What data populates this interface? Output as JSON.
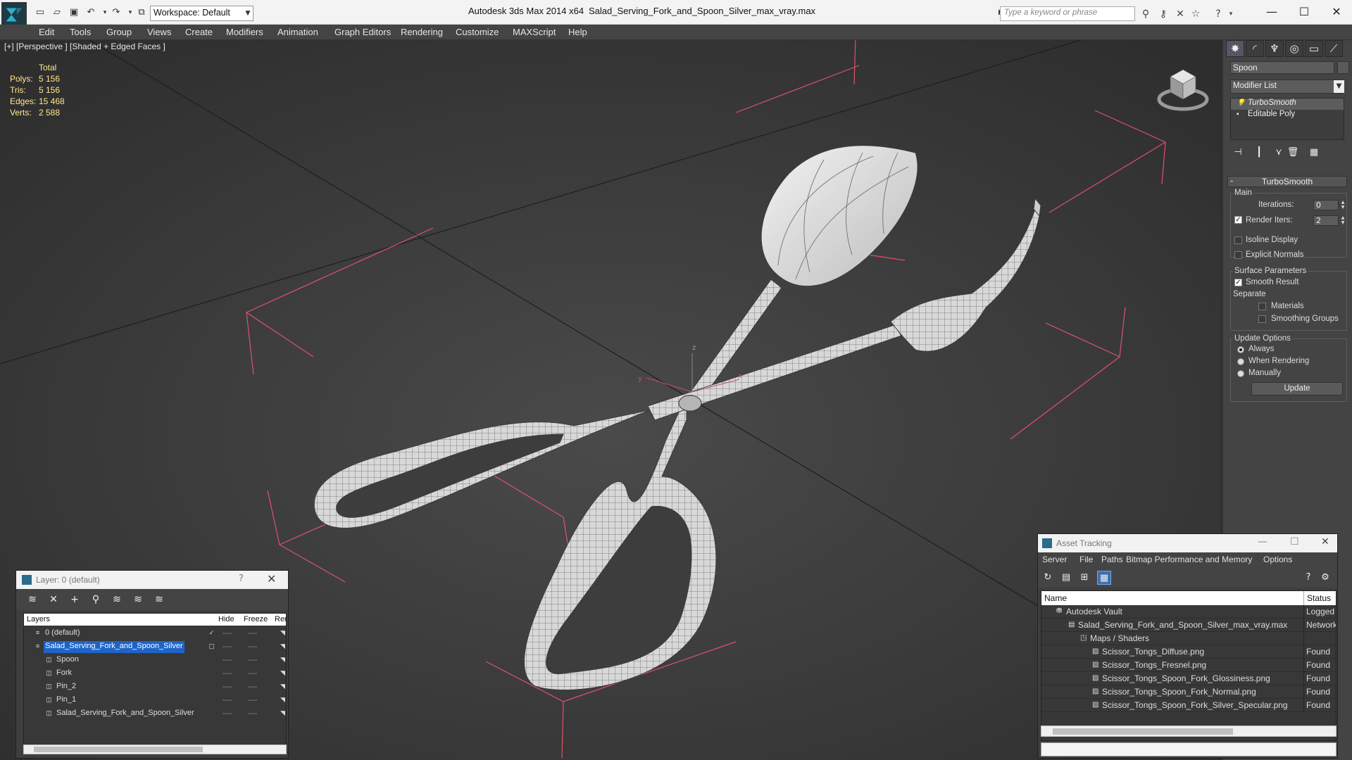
{
  "titlebar": {
    "workspace": "Workspace: Default",
    "app_title": "Autodesk 3ds Max  2014 x64",
    "file_title": "Salad_Serving_Fork_and_Spoon_Silver_max_vray.max",
    "search_placeholder": "Type a keyword or phrase"
  },
  "menu": [
    "Edit",
    "Tools",
    "Group",
    "Views",
    "Create",
    "Modifiers",
    "Animation",
    "Graph Editors",
    "Rendering",
    "Customize",
    "MAXScript",
    "Help"
  ],
  "viewport": {
    "label": "[+] [Perspective ] [Shaded + Edged Faces ]",
    "stats": {
      "header": "Total",
      "rows": [
        {
          "label": "Polys:",
          "value": "5 156"
        },
        {
          "label": "Tris:",
          "value": "5 156"
        },
        {
          "label": "Edges:",
          "value": "15 468"
        },
        {
          "label": "Verts:",
          "value": "2 588"
        }
      ]
    },
    "axis": {
      "x": "x",
      "y": "y",
      "z": "z"
    }
  },
  "command_panel": {
    "object_name": "Spoon",
    "modifier_list": "Modifier List",
    "stack": [
      "TurboSmooth",
      "Editable Poly"
    ],
    "rollout": "TurboSmooth",
    "main_group": "Main",
    "iterations_label": "Iterations:",
    "iterations_value": "0",
    "render_iters_label": "Render Iters:",
    "render_iters_value": "2",
    "isoline": "Isoline Display",
    "explicit_normals": "Explicit Normals",
    "surface_group": "Surface Parameters",
    "smooth_result": "Smooth Result",
    "separate": "Separate",
    "materials": "Materials",
    "smoothing_groups": "Smoothing Groups",
    "update_group": "Update Options",
    "always": "Always",
    "when_rendering": "When Rendering",
    "manually": "Manually",
    "update_btn": "Update"
  },
  "layer_dialog": {
    "title": "Layer: 0 (default)",
    "help": "?",
    "columns": [
      "Layers",
      "Hide",
      "Freeze",
      "Rer"
    ],
    "rows": [
      {
        "name": "0 (default)",
        "indent": 0,
        "selected": false,
        "current": true
      },
      {
        "name": "Salad_Serving_Fork_and_Spoon_Silver",
        "indent": 0,
        "selected": true,
        "current": false
      },
      {
        "name": "Spoon",
        "indent": 1,
        "selected": false,
        "current": false
      },
      {
        "name": "Fork",
        "indent": 1,
        "selected": false,
        "current": false
      },
      {
        "name": "Pin_2",
        "indent": 1,
        "selected": false,
        "current": false
      },
      {
        "name": "Pin_1",
        "indent": 1,
        "selected": false,
        "current": false
      },
      {
        "name": "Salad_Serving_Fork_and_Spoon_Silver",
        "indent": 1,
        "selected": false,
        "current": false
      }
    ],
    "dash": "----"
  },
  "asset_tracking": {
    "title": "Asset Tracking",
    "menu": [
      "Server",
      "File",
      "Paths",
      "Bitmap Performance and Memory",
      "Options"
    ],
    "columns": [
      "Name",
      "Status"
    ],
    "rows": [
      {
        "name": "Autodesk Vault",
        "indent": 1,
        "status": "Logged C"
      },
      {
        "name": "Salad_Serving_Fork_and_Spoon_Silver_max_vray.max",
        "indent": 2,
        "status": "Network"
      },
      {
        "name": "Maps / Shaders",
        "indent": 3,
        "status": ""
      },
      {
        "name": "Scissor_Tongs_Diffuse.png",
        "indent": 4,
        "status": "Found"
      },
      {
        "name": "Scissor_Tongs_Fresnel.png",
        "indent": 4,
        "status": "Found"
      },
      {
        "name": "Scissor_Tongs_Spoon_Fork_Glossiness.png",
        "indent": 4,
        "status": "Found"
      },
      {
        "name": "Scissor_Tongs_Spoon_Fork_Normal.png",
        "indent": 4,
        "status": "Found"
      },
      {
        "name": "Scissor_Tongs_Spoon_Fork_Silver_Specular.png",
        "indent": 4,
        "status": "Found"
      }
    ]
  },
  "colors": {
    "bbox": "#e0506e",
    "selection": "#1e64c8",
    "stats": "#ffe98e"
  }
}
